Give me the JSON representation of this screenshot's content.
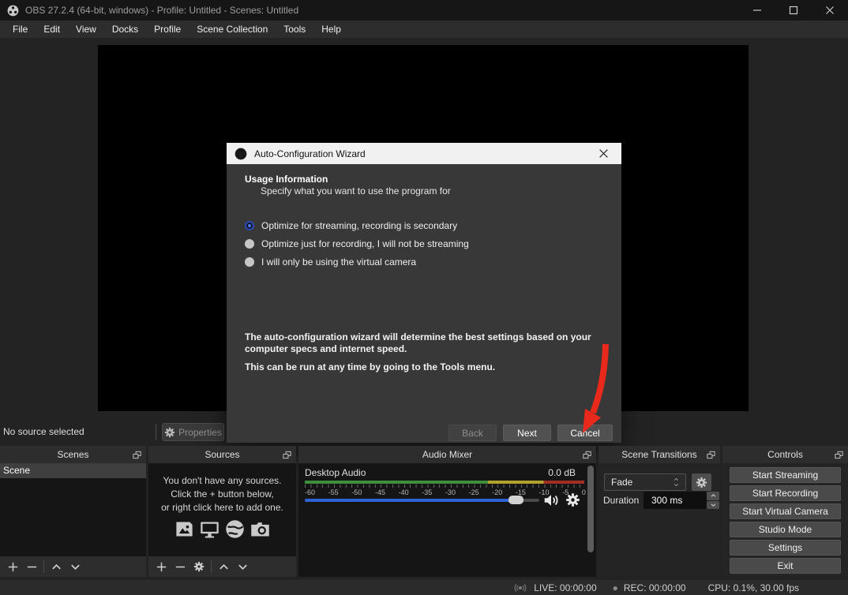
{
  "window": {
    "title": "OBS 27.2.4 (64-bit, windows) - Profile: Untitled - Scenes: Untitled"
  },
  "menu": {
    "items": [
      "File",
      "Edit",
      "View",
      "Docks",
      "Profile",
      "Scene Collection",
      "Tools",
      "Help"
    ]
  },
  "source_toolbar": {
    "status": "No source selected",
    "properties_label": "Properties"
  },
  "dialog": {
    "title": "Auto-Configuration Wizard",
    "heading": "Usage Information",
    "subheading": "Specify what you want to use the program for",
    "options": [
      {
        "label": "Optimize for streaming, recording is secondary",
        "selected": true
      },
      {
        "label": "Optimize just for recording, I will not be streaming",
        "selected": false
      },
      {
        "label": "I will only be using the virtual camera",
        "selected": false
      }
    ],
    "info_line1": "The auto-configuration wizard will determine the best settings based on your computer specs and internet speed.",
    "info_line2": "This can be run at any time by going to the Tools menu.",
    "buttons": {
      "back": "Back",
      "next": "Next",
      "cancel": "Cancel"
    }
  },
  "panels": {
    "scenes": {
      "title": "Scenes",
      "items": [
        "Scene"
      ]
    },
    "sources": {
      "title": "Sources",
      "empty_line1": "You don't have any sources.",
      "empty_line2": "Click the + button below,",
      "empty_line3": "or right click here to add one."
    },
    "audio_mixer": {
      "title": "Audio Mixer",
      "channel": "Desktop Audio",
      "level": "0.0 dB",
      "ticks": [
        "-60",
        "-55",
        "-50",
        "-45",
        "-40",
        "-35",
        "-30",
        "-25",
        "-20",
        "-15",
        "-10",
        "-5",
        "0"
      ]
    },
    "scene_transitions": {
      "title": "Scene Transitions",
      "transition": "Fade",
      "duration_label": "Duration",
      "duration_value": "300 ms"
    },
    "controls": {
      "title": "Controls",
      "buttons": [
        "Start Streaming",
        "Start Recording",
        "Start Virtual Camera",
        "Studio Mode",
        "Settings",
        "Exit"
      ]
    }
  },
  "status_bar": {
    "live": "LIVE: 00:00:00",
    "rec": "REC: 00:00:00",
    "cpu": "CPU: 0.1%, 30.00 fps"
  },
  "icons": {
    "obs-logo": "circle-shutter",
    "minimize": "–",
    "maximize": "□",
    "close": "✕",
    "gear": "gear",
    "float": "overlapping-squares",
    "plus": "+",
    "minus": "−",
    "chevron-up": "∧",
    "chevron-down": "∨",
    "speaker": "speaker-waves",
    "broadcast": "((●))",
    "rec-dot": "●"
  },
  "colors": {
    "accent_blue": "#2f62d4",
    "meter_green": "#3f8f3f",
    "meter_yellow": "#b3a22c",
    "meter_red": "#a22e26",
    "arrow_red": "#e8291c",
    "dialog_titlebar": "#f1f1f1"
  }
}
